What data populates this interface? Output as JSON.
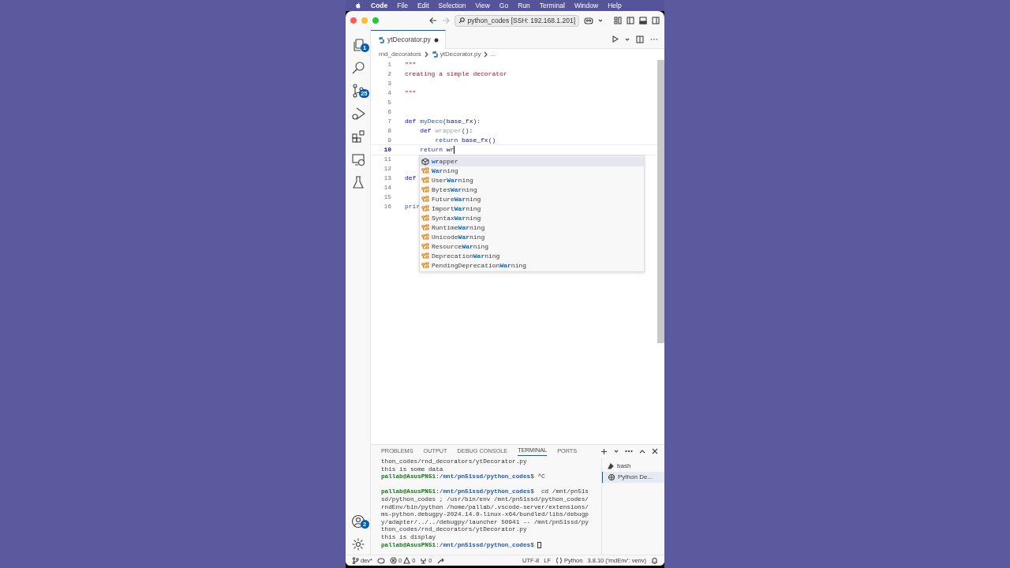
{
  "menubar": {
    "app": "Code",
    "items": [
      "File",
      "Edit",
      "Selection",
      "View",
      "Go",
      "Run",
      "Terminal",
      "Window",
      "Help"
    ]
  },
  "titlebar": {
    "search": "python_codes [SSH: 192.168.1.201]"
  },
  "activity_bar": {
    "badges": [
      {
        "kind": "explorer",
        "badge": "1"
      },
      {
        "kind": "search"
      },
      {
        "kind": "source-control",
        "badge": "25"
      },
      {
        "kind": "run-debug"
      },
      {
        "kind": "extensions"
      },
      {
        "kind": "remote"
      },
      {
        "kind": "testing"
      }
    ],
    "bottom": [
      {
        "kind": "accounts",
        "badge": "2"
      },
      {
        "kind": "settings"
      }
    ]
  },
  "tabs": [
    {
      "label": "ytDecorator.py",
      "selected": true,
      "modified": true
    }
  ],
  "breadcrumb": {
    "folder": "rnd_decorators",
    "file": "ytDecorator.py",
    "more": "..."
  },
  "editor": {
    "lines": [
      {
        "number": "1",
        "current": false,
        "tokens": [
          {
            "text": "\"\"\"",
            "kind": "string"
          }
        ]
      },
      {
        "number": "2",
        "current": false,
        "tokens": [
          {
            "text": "creating a simple decorator",
            "kind": "string"
          }
        ]
      },
      {
        "number": "3",
        "current": false
      },
      {
        "number": "4",
        "current": false,
        "tokens": [
          {
            "text": "\"\"\"",
            "kind": "string"
          }
        ]
      },
      {
        "number": "5",
        "current": false
      },
      {
        "number": "6",
        "current": false
      },
      {
        "number": "7",
        "current": false,
        "tokens": [
          {
            "text": "def",
            "kind": "keyword"
          },
          {
            "text": " myDeco",
            "kind": "function"
          },
          {
            "text": "(",
            "kind": "plain"
          },
          {
            "text": "base_fx",
            "kind": "param"
          },
          {
            "text": "):",
            "kind": "plain"
          }
        ]
      },
      {
        "number": "8",
        "current": false,
        "tokens": [
          {
            "text": "    def",
            "kind": "keyword"
          },
          {
            "text": " wrapper",
            "kind": "unused"
          },
          {
            "text": "():",
            "kind": "plain"
          }
        ]
      },
      {
        "number": "9",
        "current": false,
        "tokens": [
          {
            "text": "        return",
            "kind": "control"
          },
          {
            "text": " base_fx",
            "kind": "param"
          },
          {
            "text": "()",
            "kind": "plain"
          }
        ]
      },
      {
        "number": "10",
        "current": true,
        "tokens": [
          {
            "text": "    return",
            "kind": "control"
          },
          {
            "text": " wr",
            "kind": "param"
          }
        ]
      },
      {
        "number": "11",
        "current": false
      },
      {
        "number": "12",
        "current": false
      },
      {
        "number": "13",
        "current": false,
        "tokens": [
          {
            "text": "def",
            "kind": "keyword"
          }
        ]
      },
      {
        "number": "14",
        "current": false
      },
      {
        "number": "15",
        "current": false
      },
      {
        "number": "16",
        "current": false,
        "tokens": [
          {
            "text": "prir",
            "kind": "function"
          }
        ]
      }
    ],
    "suggestions": [
      {
        "kind": "method",
        "match": "wr",
        "suffix": "apper",
        "selected": true
      },
      {
        "kind": "class",
        "match": "War",
        "suffix": "ning",
        "selected": false
      },
      {
        "kind": "class",
        "prefix": "User",
        "match": "War",
        "suffix": "ning",
        "selected": false
      },
      {
        "kind": "class",
        "prefix": "Bytes",
        "match": "War",
        "suffix": "ning",
        "selected": false
      },
      {
        "kind": "class",
        "prefix": "Future",
        "match": "War",
        "suffix": "ning",
        "selected": false
      },
      {
        "kind": "class",
        "prefix": "Import",
        "match": "War",
        "suffix": "ning",
        "selected": false
      },
      {
        "kind": "class",
        "prefix": "Syntax",
        "match": "War",
        "suffix": "ning",
        "selected": false
      },
      {
        "kind": "class",
        "prefix": "Runtime",
        "match": "War",
        "suffix": "ning",
        "selected": false
      },
      {
        "kind": "class",
        "prefix": "Unicode",
        "match": "War",
        "suffix": "ning",
        "selected": false
      },
      {
        "kind": "class",
        "prefix": "Resource",
        "match": "War",
        "suffix": "ning",
        "selected": false
      },
      {
        "kind": "class",
        "prefix": "Deprecation",
        "match": "War",
        "suffix": "ning",
        "selected": false
      },
      {
        "kind": "class",
        "prefix": "PendingDeprecation",
        "match": "War",
        "suffix": "ning",
        "selected": false
      }
    ]
  },
  "panel": {
    "tabs": [
      {
        "label": "PROBLEMS",
        "selected": false
      },
      {
        "label": "OUTPUT",
        "selected": false
      },
      {
        "label": "DEBUG CONSOLE",
        "selected": false
      },
      {
        "label": "TERMINAL",
        "selected": true
      },
      {
        "label": "PORTS",
        "selected": false
      }
    ],
    "terminal_lines": [
      {
        "cursor": false,
        "segments": [
          {
            "text": "thon_codes/rnd_decorators/ytDecorator.py",
            "kind": "plain"
          }
        ]
      },
      {
        "cursor": false,
        "segments": [
          {
            "text": "this is some data",
            "kind": "plain"
          }
        ]
      },
      {
        "cursor": false,
        "segments": [
          {
            "text": "pallab@AsusPN51",
            "kind": "user"
          },
          {
            "text": ":",
            "kind": "plain"
          },
          {
            "text": "/mnt/pn51ssd/python_codes",
            "kind": "path"
          },
          {
            "text": "$ ^C",
            "kind": "plain"
          }
        ]
      },
      {
        "cursor": false
      },
      {
        "cursor": false,
        "segments": [
          {
            "text": "pallab@AsusPN51",
            "kind": "user"
          },
          {
            "text": ":",
            "kind": "plain"
          },
          {
            "text": "/mnt/pn51ssd/python_codes",
            "kind": "path"
          },
          {
            "text": "$  cd /mnt/pn51s",
            "kind": "plain"
          }
        ]
      },
      {
        "cursor": false,
        "segments": [
          {
            "text": "sd/python_codes ; /usr/bin/env /mnt/pn51ssd/python_codes/",
            "kind": "plain"
          }
        ]
      },
      {
        "cursor": false,
        "segments": [
          {
            "text": "rndEnv/bin/python /home/pallab/.vscode-server/extensions/",
            "kind": "plain"
          }
        ]
      },
      {
        "cursor": false,
        "segments": [
          {
            "text": "ms-python.debugpy-2024.14.0-linux-x64/bundled/libs/debugp",
            "kind": "plain"
          }
        ]
      },
      {
        "cursor": false,
        "segments": [
          {
            "text": "y/adapter/../../debugpy/launcher 50941 -- /mnt/pn51ssd/py",
            "kind": "plain"
          }
        ]
      },
      {
        "cursor": false,
        "segments": [
          {
            "text": "thon_codes/rnd_decorators/ytDecorator.py",
            "kind": "plain"
          }
        ]
      },
      {
        "cursor": false,
        "segments": [
          {
            "text": "this is display",
            "kind": "plain"
          }
        ]
      },
      {
        "cursor": true,
        "segments": [
          {
            "text": "pallab@AsusPN51",
            "kind": "user"
          },
          {
            "text": ":",
            "kind": "plain"
          },
          {
            "text": "/mnt/pn51ssd/python_codes",
            "kind": "path"
          },
          {
            "text": "$ ",
            "kind": "plain"
          }
        ]
      }
    ],
    "terminals": [
      {
        "kind": "bash",
        "label": "bash",
        "selected": false
      },
      {
        "kind": "debug",
        "label": "Python De...",
        "selected": true
      }
    ]
  },
  "status_bar": {
    "branch": "dev*",
    "errors": "0",
    "warnings": "0",
    "ports": "0",
    "encoding": "UTF-8",
    "eol": "LF",
    "language": "Python",
    "interpreter": "3.8.10 ('rndEnv': venv)"
  }
}
